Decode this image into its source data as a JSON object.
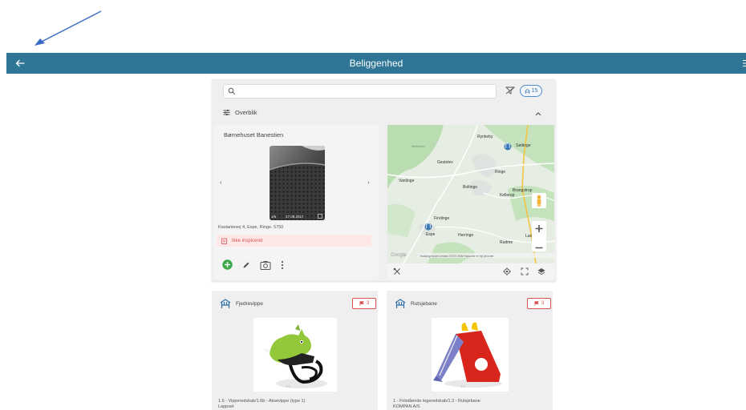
{
  "topbar": {
    "title": "Beliggenhed"
  },
  "search": {
    "placeholder": "",
    "count": "15"
  },
  "overview": {
    "label": "Overblik"
  },
  "location": {
    "name": "Børnehuset Banestien",
    "address": "Kastanievej 4, Espe, Ringe. 5750",
    "status": "Ikke inspiceret",
    "photo_counter": "1/6",
    "photo_date": "27.08.2017"
  },
  "map": {
    "towns": [
      "Rynkeby",
      "Sødinge",
      "Gestelev",
      "Ringe",
      "Vantinge",
      "Boltinge",
      "Kellerup",
      "Brangstrup",
      "Findinge",
      "Espe",
      "Herringe",
      "Rudme",
      "Lang",
      "Hindsholm"
    ],
    "footer": "Tastaturgenveje   Kortdata ©2023   Vilkår   Rapporter en fejl på kortet",
    "logo": "Google"
  },
  "items": [
    {
      "name": "Fjedrevippe",
      "flag_count": "3",
      "description": "1.6 - Vipperedskab/1.6b - Aksevippe (type 1)",
      "description2": "Lappset",
      "counter": "1/1"
    },
    {
      "name": "Rutsjebane",
      "flag_count": "3",
      "description": "1 - Fritstående legeredskab/1.3 - Rutsjebane",
      "description2": "KOMPAN A/S",
      "counter": "1/1"
    }
  ],
  "colors": {
    "topbar": "#2e7596",
    "accent": "#3a78b5",
    "danger": "#d9534f",
    "add": "#3aa84b"
  }
}
